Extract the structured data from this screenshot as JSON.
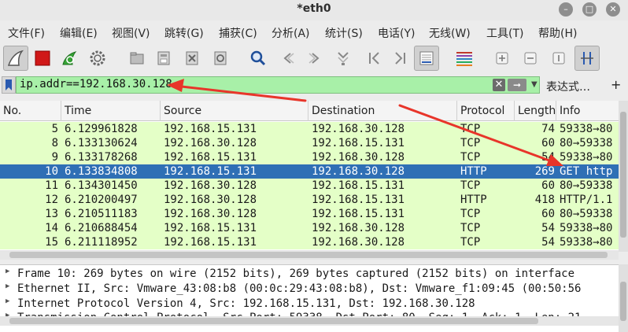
{
  "window": {
    "title": "*eth0"
  },
  "menu": [
    "文件(F)",
    "编辑(E)",
    "视图(V)",
    "跳转(G)",
    "捕获(C)",
    "分析(A)",
    "统计(S)",
    "电话(Y)",
    "无线(W)",
    "工具(T)",
    "帮助(H)"
  ],
  "filter": {
    "value": "ip.addr==192.168.30.128",
    "expression_label": "表达式…",
    "add_label": "+"
  },
  "packet_list": {
    "columns": [
      "No.",
      "Time",
      "Source",
      "Destination",
      "Protocol",
      "Length",
      "Info"
    ],
    "rows": [
      {
        "no": "5",
        "time": "6.129961828",
        "src": "192.168.15.131",
        "dst": "192.168.30.128",
        "proto": "TCP",
        "len": "74",
        "info": "59338→80",
        "selected": false
      },
      {
        "no": "8",
        "time": "6.133130624",
        "src": "192.168.30.128",
        "dst": "192.168.15.131",
        "proto": "TCP",
        "len": "60",
        "info": "80→59338",
        "selected": false
      },
      {
        "no": "9",
        "time": "6.133178268",
        "src": "192.168.15.131",
        "dst": "192.168.30.128",
        "proto": "TCP",
        "len": "54",
        "info": "59338→80",
        "selected": false
      },
      {
        "no": "10",
        "time": "6.133834808",
        "src": "192.168.15.131",
        "dst": "192.168.30.128",
        "proto": "HTTP",
        "len": "269",
        "info": "GET http",
        "selected": true
      },
      {
        "no": "11",
        "time": "6.134301450",
        "src": "192.168.30.128",
        "dst": "192.168.15.131",
        "proto": "TCP",
        "len": "60",
        "info": "80→59338",
        "selected": false
      },
      {
        "no": "12",
        "time": "6.210200497",
        "src": "192.168.30.128",
        "dst": "192.168.15.131",
        "proto": "HTTP",
        "len": "418",
        "info": "HTTP/1.1",
        "selected": false
      },
      {
        "no": "13",
        "time": "6.210511183",
        "src": "192.168.30.128",
        "dst": "192.168.15.131",
        "proto": "TCP",
        "len": "60",
        "info": "80→59338",
        "selected": false
      },
      {
        "no": "14",
        "time": "6.210688454",
        "src": "192.168.15.131",
        "dst": "192.168.30.128",
        "proto": "TCP",
        "len": "54",
        "info": "59338→80",
        "selected": false
      },
      {
        "no": "15",
        "time": "6.211118952",
        "src": "192.168.15.131",
        "dst": "192.168.30.128",
        "proto": "TCP",
        "len": "54",
        "info": "59338→80",
        "selected": false
      }
    ]
  },
  "details": [
    "Frame 10: 269 bytes on wire (2152 bits), 269 bytes captured (2152 bits) on interface",
    "Ethernet II, Src: Vmware_43:08:b8 (00:0c:29:43:08:b8), Dst: Vmware_f1:09:45 (00:50:56",
    "Internet Protocol Version 4, Src: 192.168.15.131, Dst: 192.168.30.128",
    "Transmission Control Protocol, Src Port: 59338, Dst Port: 80, Seq: 1, Ack: 1, Len: 21"
  ],
  "colors": {
    "row_bg": "#e4ffc7",
    "selected_bg": "#2f6fb5",
    "filter_bg": "#a8f0a8",
    "annotation": "#e8352a"
  },
  "icons": [
    "shark-fin-start-icon",
    "stop-icon",
    "restart-icon",
    "options-gear-icon",
    "open-folder-icon",
    "save-icon",
    "close-file-icon",
    "reload-icon",
    "search-icon",
    "go-back-icon",
    "go-forward-icon",
    "go-to-packet-icon",
    "first-packet-icon",
    "last-packet-icon",
    "autoscroll-icon",
    "colorize-icon",
    "zoom-in-icon",
    "zoom-out-icon",
    "normal-size-icon",
    "resize-columns-icon"
  ]
}
